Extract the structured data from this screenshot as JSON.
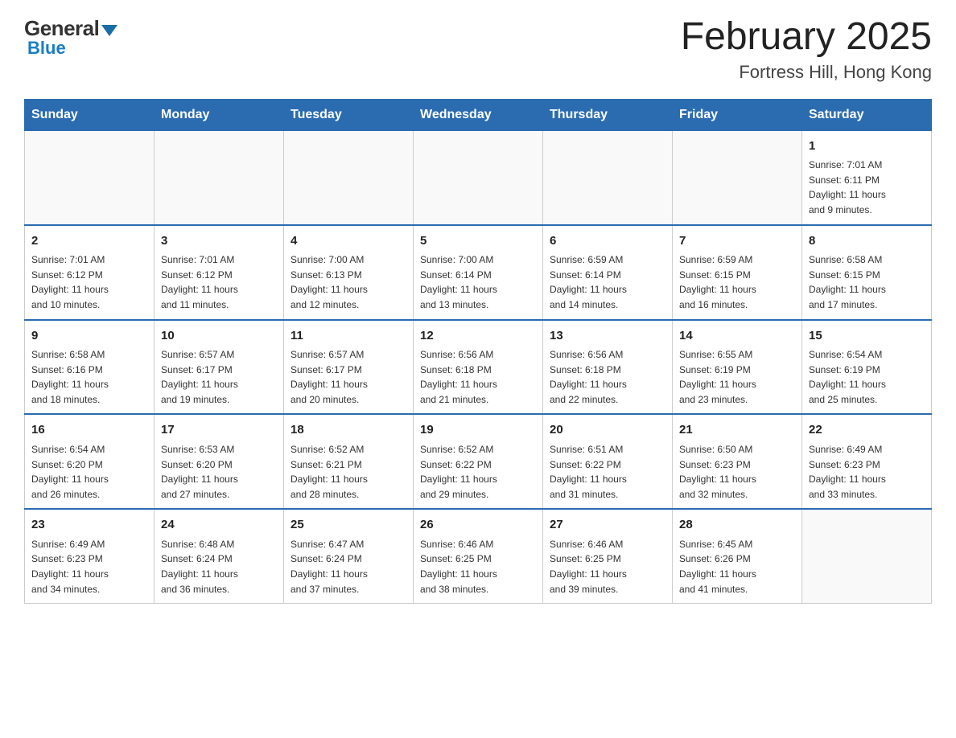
{
  "logo": {
    "general": "General",
    "blue": "Blue"
  },
  "title": "February 2025",
  "location": "Fortress Hill, Hong Kong",
  "days_of_week": [
    "Sunday",
    "Monday",
    "Tuesday",
    "Wednesday",
    "Thursday",
    "Friday",
    "Saturday"
  ],
  "weeks": [
    [
      {
        "day": "",
        "info": ""
      },
      {
        "day": "",
        "info": ""
      },
      {
        "day": "",
        "info": ""
      },
      {
        "day": "",
        "info": ""
      },
      {
        "day": "",
        "info": ""
      },
      {
        "day": "",
        "info": ""
      },
      {
        "day": "1",
        "info": "Sunrise: 7:01 AM\nSunset: 6:11 PM\nDaylight: 11 hours\nand 9 minutes."
      }
    ],
    [
      {
        "day": "2",
        "info": "Sunrise: 7:01 AM\nSunset: 6:12 PM\nDaylight: 11 hours\nand 10 minutes."
      },
      {
        "day": "3",
        "info": "Sunrise: 7:01 AM\nSunset: 6:12 PM\nDaylight: 11 hours\nand 11 minutes."
      },
      {
        "day": "4",
        "info": "Sunrise: 7:00 AM\nSunset: 6:13 PM\nDaylight: 11 hours\nand 12 minutes."
      },
      {
        "day": "5",
        "info": "Sunrise: 7:00 AM\nSunset: 6:14 PM\nDaylight: 11 hours\nand 13 minutes."
      },
      {
        "day": "6",
        "info": "Sunrise: 6:59 AM\nSunset: 6:14 PM\nDaylight: 11 hours\nand 14 minutes."
      },
      {
        "day": "7",
        "info": "Sunrise: 6:59 AM\nSunset: 6:15 PM\nDaylight: 11 hours\nand 16 minutes."
      },
      {
        "day": "8",
        "info": "Sunrise: 6:58 AM\nSunset: 6:15 PM\nDaylight: 11 hours\nand 17 minutes."
      }
    ],
    [
      {
        "day": "9",
        "info": "Sunrise: 6:58 AM\nSunset: 6:16 PM\nDaylight: 11 hours\nand 18 minutes."
      },
      {
        "day": "10",
        "info": "Sunrise: 6:57 AM\nSunset: 6:17 PM\nDaylight: 11 hours\nand 19 minutes."
      },
      {
        "day": "11",
        "info": "Sunrise: 6:57 AM\nSunset: 6:17 PM\nDaylight: 11 hours\nand 20 minutes."
      },
      {
        "day": "12",
        "info": "Sunrise: 6:56 AM\nSunset: 6:18 PM\nDaylight: 11 hours\nand 21 minutes."
      },
      {
        "day": "13",
        "info": "Sunrise: 6:56 AM\nSunset: 6:18 PM\nDaylight: 11 hours\nand 22 minutes."
      },
      {
        "day": "14",
        "info": "Sunrise: 6:55 AM\nSunset: 6:19 PM\nDaylight: 11 hours\nand 23 minutes."
      },
      {
        "day": "15",
        "info": "Sunrise: 6:54 AM\nSunset: 6:19 PM\nDaylight: 11 hours\nand 25 minutes."
      }
    ],
    [
      {
        "day": "16",
        "info": "Sunrise: 6:54 AM\nSunset: 6:20 PM\nDaylight: 11 hours\nand 26 minutes."
      },
      {
        "day": "17",
        "info": "Sunrise: 6:53 AM\nSunset: 6:20 PM\nDaylight: 11 hours\nand 27 minutes."
      },
      {
        "day": "18",
        "info": "Sunrise: 6:52 AM\nSunset: 6:21 PM\nDaylight: 11 hours\nand 28 minutes."
      },
      {
        "day": "19",
        "info": "Sunrise: 6:52 AM\nSunset: 6:22 PM\nDaylight: 11 hours\nand 29 minutes."
      },
      {
        "day": "20",
        "info": "Sunrise: 6:51 AM\nSunset: 6:22 PM\nDaylight: 11 hours\nand 31 minutes."
      },
      {
        "day": "21",
        "info": "Sunrise: 6:50 AM\nSunset: 6:23 PM\nDaylight: 11 hours\nand 32 minutes."
      },
      {
        "day": "22",
        "info": "Sunrise: 6:49 AM\nSunset: 6:23 PM\nDaylight: 11 hours\nand 33 minutes."
      }
    ],
    [
      {
        "day": "23",
        "info": "Sunrise: 6:49 AM\nSunset: 6:23 PM\nDaylight: 11 hours\nand 34 minutes."
      },
      {
        "day": "24",
        "info": "Sunrise: 6:48 AM\nSunset: 6:24 PM\nDaylight: 11 hours\nand 36 minutes."
      },
      {
        "day": "25",
        "info": "Sunrise: 6:47 AM\nSunset: 6:24 PM\nDaylight: 11 hours\nand 37 minutes."
      },
      {
        "day": "26",
        "info": "Sunrise: 6:46 AM\nSunset: 6:25 PM\nDaylight: 11 hours\nand 38 minutes."
      },
      {
        "day": "27",
        "info": "Sunrise: 6:46 AM\nSunset: 6:25 PM\nDaylight: 11 hours\nand 39 minutes."
      },
      {
        "day": "28",
        "info": "Sunrise: 6:45 AM\nSunset: 6:26 PM\nDaylight: 11 hours\nand 41 minutes."
      },
      {
        "day": "",
        "info": ""
      }
    ]
  ]
}
